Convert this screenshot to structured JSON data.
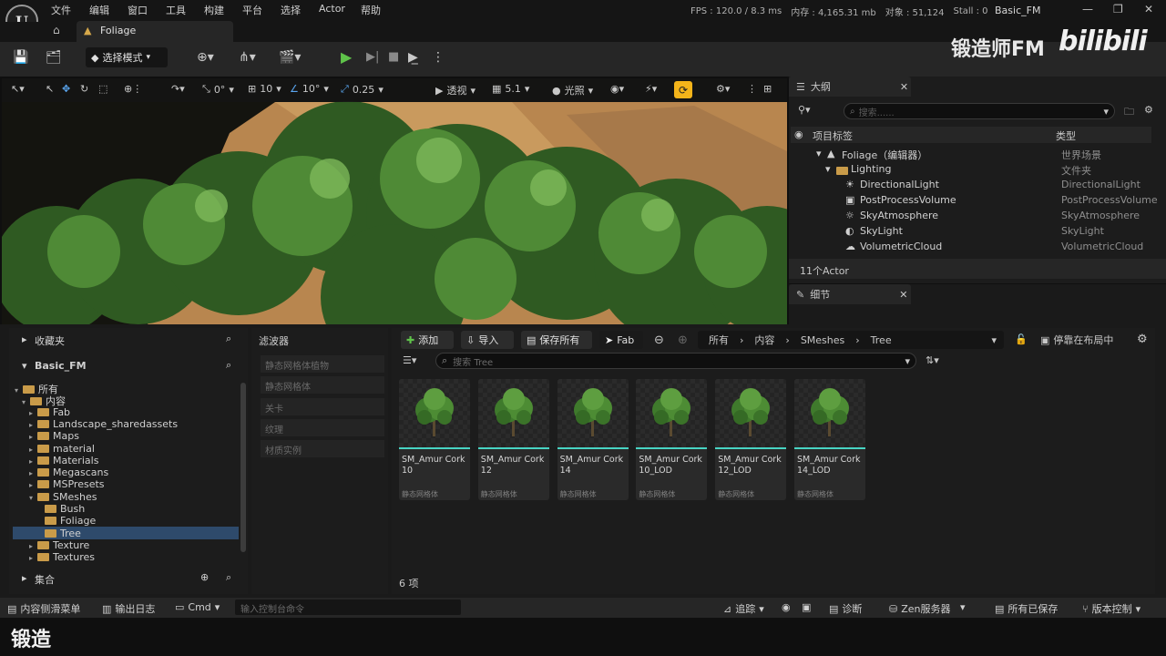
{
  "menu": [
    "文件",
    "编辑",
    "窗口",
    "工具",
    "构建",
    "平台",
    "选择",
    "Actor",
    "帮助"
  ],
  "stats": {
    "fps": "FPS : 120.0 / 8.3 ms",
    "memory": "内存 : 4,165.31 mb",
    "objects": "对象 : 51,124",
    "stalls": "Stall : 0"
  },
  "project_name": "Basic_FM",
  "level_tab": "Foliage",
  "toolbar": {
    "mode": "选择模式",
    "watermark": "锻造师FM",
    "site_logo": "bilibili"
  },
  "viewport": {
    "perspective": "透视",
    "lighting": "光照",
    "fov": "5.1",
    "rotate_snap": "0°",
    "grid_snap": "10",
    "angle_snap": "10°",
    "scale_snap": "0.25"
  },
  "outliner": {
    "title": "大纲",
    "search_placeholder": "搜索......",
    "col_label": "项目标签",
    "col_type": "类型",
    "rows": [
      {
        "name": "Foliage（编辑器）",
        "type": "世界场景"
      },
      {
        "name": "Lighting",
        "type": "文件夹"
      },
      {
        "name": "DirectionalLight",
        "type": "DirectionalLight"
      },
      {
        "name": "PostProcessVolume",
        "type": "PostProcessVolume"
      },
      {
        "name": "SkyAtmosphere",
        "type": "SkyAtmosphere"
      },
      {
        "name": "SkyLight",
        "type": "SkyLight"
      },
      {
        "name": "VolumetricCloud",
        "type": "VolumetricCloud"
      }
    ],
    "count": "11个Actor"
  },
  "details": {
    "title": "细节"
  },
  "content_browser": {
    "favorites": "收藏夹",
    "project": "Basic_FM",
    "collections": "集合",
    "filters_title": "滤波器",
    "filters": [
      "静态网格体植物",
      "静态网格体",
      "关卡",
      "纹理",
      "材质实例"
    ],
    "add": "添加",
    "import": "导入",
    "save_all": "保存所有",
    "fab": "Fab",
    "path": [
      "所有",
      "内容",
      "SMeshes",
      "Tree"
    ],
    "dock": "停靠在布局中",
    "search_placeholder": "搜索 Tree",
    "item_count": "6 项",
    "tree": [
      {
        "label": "所有",
        "indent": 0
      },
      {
        "label": "内容",
        "indent": 1
      },
      {
        "label": "Fab",
        "indent": 2
      },
      {
        "label": "Landscape_sharedassets",
        "indent": 2
      },
      {
        "label": "Maps",
        "indent": 2
      },
      {
        "label": "material",
        "indent": 2
      },
      {
        "label": "Materials",
        "indent": 2
      },
      {
        "label": "Megascans",
        "indent": 2
      },
      {
        "label": "MSPresets",
        "indent": 2
      },
      {
        "label": "SMeshes",
        "indent": 2
      },
      {
        "label": "Bush",
        "indent": 3
      },
      {
        "label": "Foliage",
        "indent": 3
      },
      {
        "label": "Tree",
        "indent": 3
      },
      {
        "label": "Texture",
        "indent": 2
      },
      {
        "label": "Textures",
        "indent": 2
      }
    ],
    "assets": [
      {
        "name": "SM_Amur Cork10",
        "type": "静态网格体"
      },
      {
        "name": "SM_Amur Cork12",
        "type": "静态网格体"
      },
      {
        "name": "SM_Amur Cork14",
        "type": "静态网格体"
      },
      {
        "name": "SM_Amur Cork10_LOD",
        "type": "静态网格体"
      },
      {
        "name": "SM_Amur Cork12_LOD",
        "type": "静态网格体"
      },
      {
        "name": "SM_Amur Cork14_LOD",
        "type": "静态网格体"
      }
    ]
  },
  "statusbar": {
    "drawer": "内容侧滑菜单",
    "output": "输出日志",
    "cmd": "Cmd",
    "cmd_placeholder": "输入控制台命令",
    "trace": "追踪",
    "diag": "诊断",
    "zen": "Zen服务器",
    "saved": "所有已保存",
    "vcs": "版本控制"
  },
  "subtitle": "锻造",
  "colors": {
    "accent_green": "#5fc34a",
    "asset_bar": "#47d4c3",
    "folder": "#c99b49",
    "highlight": "#f4b41a",
    "selection": "#2e4a6b"
  }
}
